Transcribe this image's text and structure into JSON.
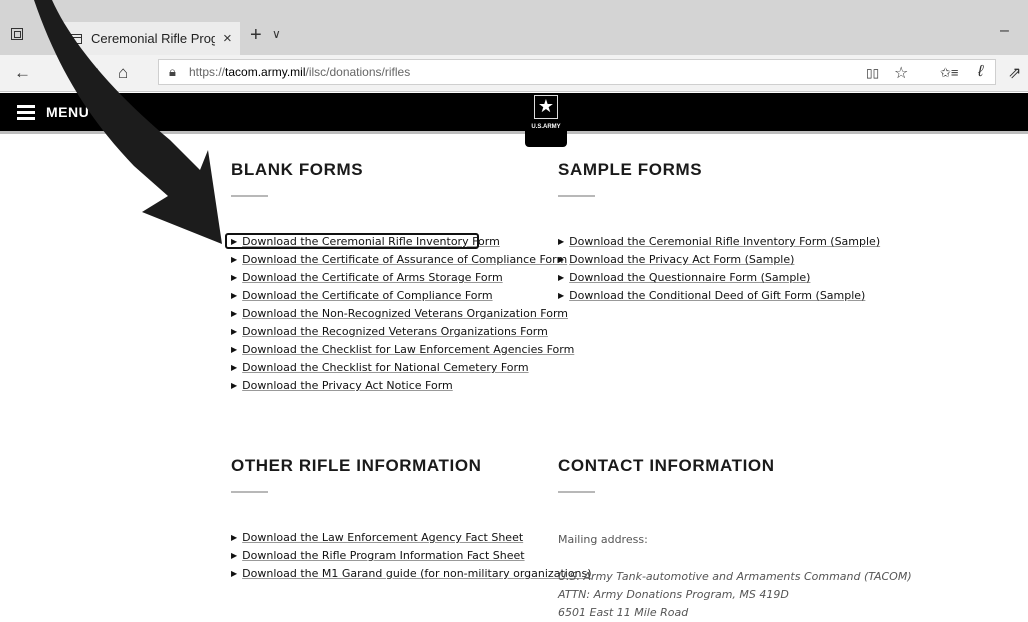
{
  "browser": {
    "tab_title": "Ceremonial Rifle Progra",
    "tab_close": "×",
    "new_tab": "+",
    "tab_list": "∨",
    "minimize": "–",
    "url_prefix": "https://",
    "url_host": "tacom.army.mil",
    "url_path": "/ilsc/donations/rifles",
    "nav": {
      "back": "←",
      "refresh": "↻",
      "home": "⌂"
    },
    "tools": {
      "reading_view": "▯▯",
      "favorite": "☆",
      "favorites_hub": "✩≡",
      "notes": "ℓ",
      "share": "⇗"
    }
  },
  "header": {
    "menu_label": "MENU",
    "logo_star": "★",
    "logo_text": "U.S.ARMY"
  },
  "sections": {
    "blank_forms": {
      "title": "BLANK FORMS",
      "links": [
        "Download the Ceremonial Rifle Inventory Form",
        "Download the Certificate of Assurance of Compliance Form",
        "Download the Certificate of Arms Storage Form",
        "Download the Certificate of Compliance Form",
        "Download the Non-Recognized Veterans Organization Form",
        "Download the Recognized Veterans Organizations Form",
        "Download the Checklist for Law Enforcement Agencies Form",
        "Download the Checklist for National Cemetery Form",
        "Download the Privacy Act Notice Form"
      ]
    },
    "sample_forms": {
      "title": "SAMPLE FORMS",
      "links": [
        "Download the Ceremonial Rifle Inventory Form (Sample)",
        "Download the Privacy Act Form (Sample)",
        "Download the Questionnaire Form (Sample)",
        "Download the Conditional Deed of Gift Form (Sample)"
      ]
    },
    "other_rifle_info": {
      "title": "OTHER RIFLE INFORMATION",
      "links": [
        "Download the Law Enforcement Agency Fact Sheet",
        "Download the Rifle Program Information Fact Sheet",
        "Download the M1 Garand guide (for non-military organizations)"
      ]
    },
    "contact_info": {
      "title": "CONTACT INFORMATION",
      "mailing_label": "Mailing address:",
      "address_lines": [
        "U.S. Army Tank-automotive and Armaments Command (TACOM)",
        "ATTN: Army Donations Program, MS 419D",
        "6501 East 11 Mile Road"
      ]
    }
  },
  "bullet_glyph": "▶",
  "colors": {
    "header_bg": "#000000",
    "tabstrip_bg": "#d4d4d4",
    "annotation": "#1c1c1c"
  }
}
